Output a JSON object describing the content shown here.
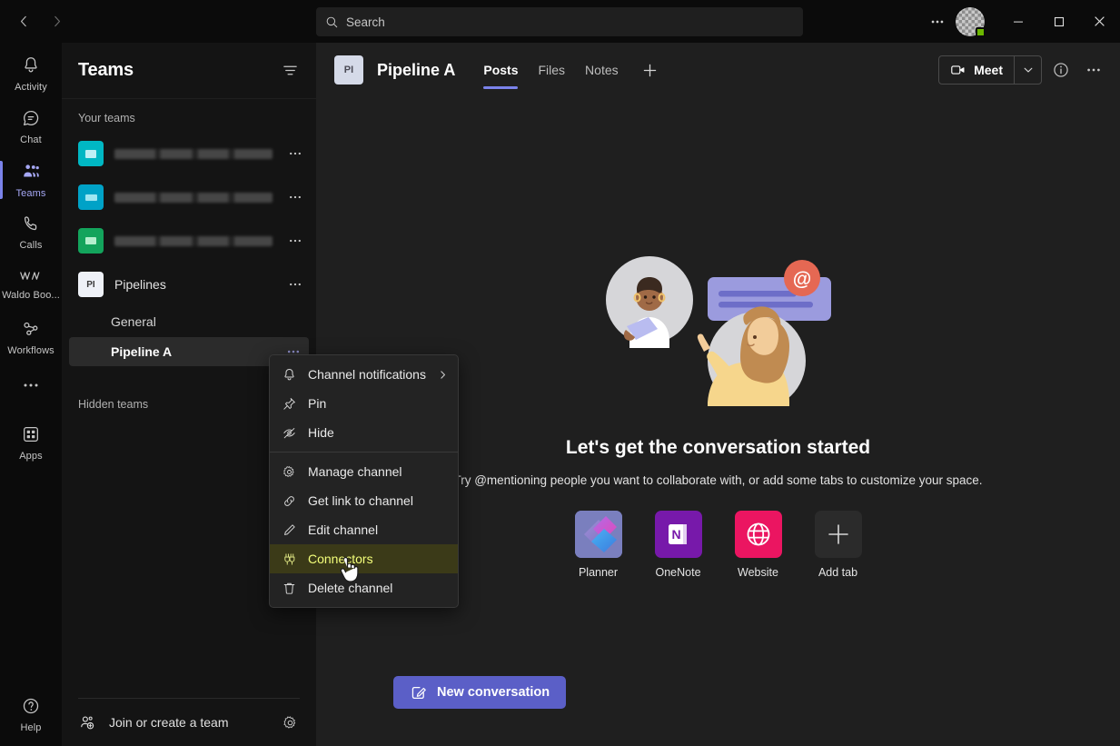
{
  "titlebar": {
    "back_label": "Back",
    "forward_label": "Forward",
    "more_label": "Settings and more",
    "minimize_label": "Minimize",
    "maximize_label": "Maximize",
    "close_label": "Close"
  },
  "search": {
    "placeholder": "Search",
    "value": ""
  },
  "rail": {
    "items": [
      {
        "label": "Activity",
        "icon": "bell-icon",
        "active": false
      },
      {
        "label": "Chat",
        "icon": "chat-icon",
        "active": false
      },
      {
        "label": "Teams",
        "icon": "teams-icon",
        "active": true
      },
      {
        "label": "Calls",
        "icon": "phone-icon",
        "active": false
      },
      {
        "label": "Waldo Boo...",
        "icon": "waldo-icon",
        "active": false
      },
      {
        "label": "Workflows",
        "icon": "workflows-icon",
        "active": false
      }
    ],
    "more_label": "More apps",
    "apps": {
      "label": "Apps",
      "icon": "apps-grid-icon"
    },
    "help": {
      "label": "Help",
      "icon": "help-circle-icon"
    }
  },
  "sidebar": {
    "title": "Teams",
    "filter_icon": "filter-icon",
    "section_label": "Your teams",
    "teams": [
      {
        "initials": "",
        "name": "",
        "redacted": true,
        "color": "#00b7c3",
        "width": "w1"
      },
      {
        "initials": "",
        "name": "",
        "redacted": true,
        "color": "#00a2c7",
        "width": "w2"
      },
      {
        "initials": "",
        "name": "",
        "redacted": true,
        "color": "#13a45c",
        "width": "w3"
      },
      {
        "initials": "PI",
        "name": "Pipelines",
        "redacted": false,
        "color": "#eef1f7",
        "width": ""
      }
    ],
    "channels": [
      {
        "name": "General",
        "selected": false
      },
      {
        "name": "Pipeline A",
        "selected": true
      }
    ],
    "hidden_teams_label": "Hidden teams",
    "join_label": "Join or create a team",
    "settings_icon": "gear-icon"
  },
  "channel": {
    "avatar_initials": "PI",
    "title": "Pipeline A",
    "tabs": [
      {
        "label": "Posts",
        "active": true
      },
      {
        "label": "Files",
        "active": false
      },
      {
        "label": "Notes",
        "active": false
      }
    ],
    "add_tab_icon": "plus-icon",
    "meet_label": "Meet",
    "meet_caret_icon": "chevron-down-icon",
    "info_icon": "info-icon",
    "more_icon": "more-horizontal-icon"
  },
  "empty_state": {
    "title": "Let's get the conversation started",
    "subtitle": "Try @mentioning people you want to collaborate with, or add some tabs to customize your space.",
    "apps": [
      {
        "label": "Planner",
        "icon": "planner-icon"
      },
      {
        "label": "OneNote",
        "icon": "onenote-icon"
      },
      {
        "label": "Website",
        "icon": "globe-icon"
      },
      {
        "label": "Add tab",
        "icon": "plus-icon"
      }
    ]
  },
  "compose": {
    "new_conversation_label": "New conversation",
    "compose_icon": "compose-icon"
  },
  "context_menu": {
    "items": [
      {
        "label": "Channel notifications",
        "icon": "bell-icon",
        "submenu": true,
        "highlight": false
      },
      {
        "label": "Pin",
        "icon": "pin-icon",
        "submenu": false,
        "highlight": false
      },
      {
        "label": "Hide",
        "icon": "eye-off-icon",
        "submenu": false,
        "highlight": false
      },
      {
        "separator": true
      },
      {
        "label": "Manage channel",
        "icon": "gear-icon",
        "submenu": false,
        "highlight": false
      },
      {
        "label": "Get link to channel",
        "icon": "link-icon",
        "submenu": false,
        "highlight": false
      },
      {
        "label": "Edit channel",
        "icon": "pencil-icon",
        "submenu": false,
        "highlight": false
      },
      {
        "label": "Connectors",
        "icon": "connectors-icon",
        "submenu": false,
        "highlight": true
      },
      {
        "label": "Delete channel",
        "icon": "trash-icon",
        "submenu": false,
        "highlight": false
      }
    ]
  },
  "colors": {
    "accent": "#5b5fc7",
    "tab_underline": "#7b83eb",
    "highlight_bg": "#3b3a18",
    "highlight_text": "#f4ff7a",
    "presence_online": "#6bb700"
  }
}
